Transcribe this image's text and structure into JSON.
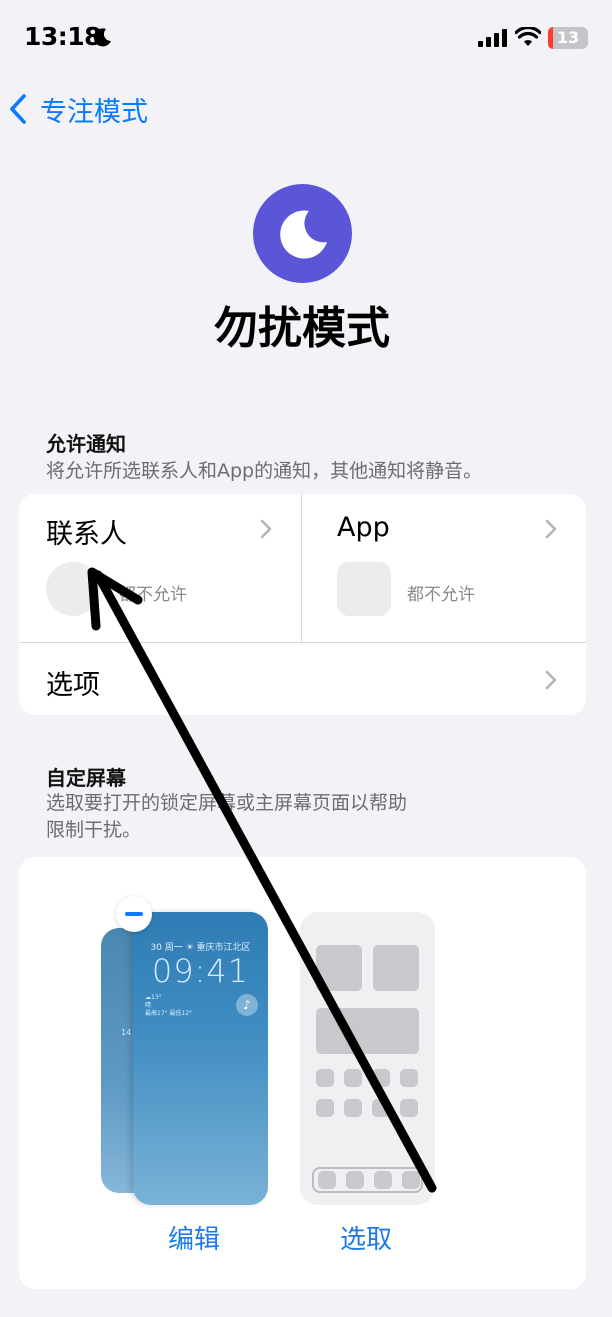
{
  "status_bar": {
    "time": "13:18",
    "battery": "13",
    "icons": [
      "moon-icon",
      "signal-icon",
      "wifi-icon",
      "battery-icon"
    ]
  },
  "nav": {
    "back_label": "专注模式"
  },
  "hero": {
    "title": "勿扰模式",
    "icon": "moon-icon",
    "icon_color": "#5B56D8"
  },
  "allow_notifications": {
    "title": "允许通知",
    "description": "将允许所选联系人和App的通知，其他通知将静音。",
    "contacts": {
      "label": "联系人",
      "status": "都不允许"
    },
    "apps": {
      "label": "App",
      "status": "都不允许"
    },
    "options_label": "选项"
  },
  "custom_screens": {
    "title": "自定屏幕",
    "description_line1": "选取要打开的锁定屏幕或主屏幕页面以帮助",
    "description_line2": "限制干扰。",
    "lock_screen": {
      "date": "30 周一 ☀ 重庆市江北区",
      "time": "09:41",
      "back_text": "14"
    },
    "edit_label": "编辑",
    "choose_label": "选取"
  },
  "colors": {
    "accent": "#0A7AFF",
    "background": "#F2F2F7"
  }
}
